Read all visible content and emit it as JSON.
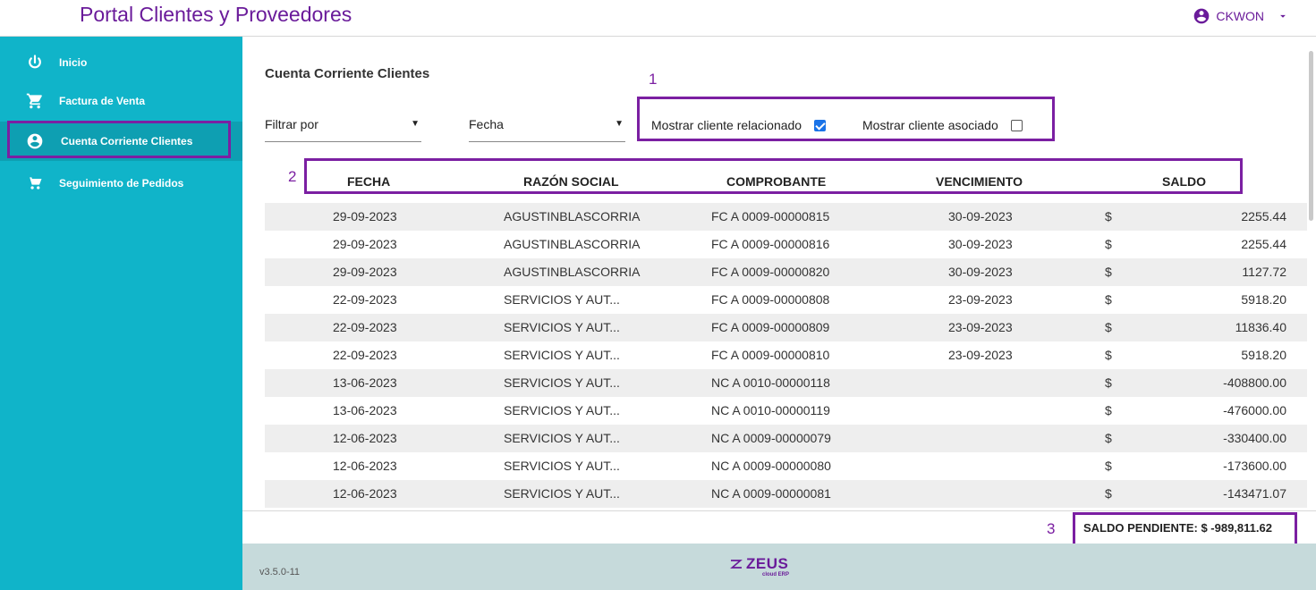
{
  "app": {
    "title": "Portal Clientes y Proveedores",
    "user": "CKWON"
  },
  "sidebar": {
    "items": [
      {
        "label": "Inicio",
        "icon": "power-icon"
      },
      {
        "label": "Factura de Venta",
        "icon": "cart-icon"
      },
      {
        "label": "Cuenta Corriente Clientes",
        "icon": "account-circle-icon",
        "active": true
      },
      {
        "label": "Seguimiento de Pedidos",
        "icon": "shopping-tracking-icon"
      }
    ]
  },
  "main": {
    "title": "Cuenta Corriente Clientes",
    "filter_select": {
      "value": "Filtrar por"
    },
    "fecha_select": {
      "value": "Fecha"
    },
    "checkbox_relacionado": {
      "label": "Mostrar cliente relacionado",
      "checked": true
    },
    "checkbox_asociado": {
      "label": "Mostrar cliente asociado",
      "checked": false
    },
    "table": {
      "headers": [
        "FECHA",
        "RAZÓN SOCIAL",
        "COMPROBANTE",
        "VENCIMIENTO",
        "SALDO"
      ],
      "rows": [
        {
          "fecha": "29-09-2023",
          "razon": "AGUSTINBLASCORRIA",
          "comprobante": "FC A 0009-00000815",
          "vencimiento": "30-09-2023",
          "moneda": "$",
          "saldo": "2255.44"
        },
        {
          "fecha": "29-09-2023",
          "razon": "AGUSTINBLASCORRIA",
          "comprobante": "FC A 0009-00000816",
          "vencimiento": "30-09-2023",
          "moneda": "$",
          "saldo": "2255.44"
        },
        {
          "fecha": "29-09-2023",
          "razon": "AGUSTINBLASCORRIA",
          "comprobante": "FC A 0009-00000820",
          "vencimiento": "30-09-2023",
          "moneda": "$",
          "saldo": "1127.72"
        },
        {
          "fecha": "22-09-2023",
          "razon": "SERVICIOS Y AUT...",
          "comprobante": "FC A 0009-00000808",
          "vencimiento": "23-09-2023",
          "moneda": "$",
          "saldo": "5918.20"
        },
        {
          "fecha": "22-09-2023",
          "razon": "SERVICIOS Y AUT...",
          "comprobante": "FC A 0009-00000809",
          "vencimiento": "23-09-2023",
          "moneda": "$",
          "saldo": "11836.40"
        },
        {
          "fecha": "22-09-2023",
          "razon": "SERVICIOS Y AUT...",
          "comprobante": "FC A 0009-00000810",
          "vencimiento": "23-09-2023",
          "moneda": "$",
          "saldo": "5918.20"
        },
        {
          "fecha": "13-06-2023",
          "razon": "SERVICIOS Y AUT...",
          "comprobante": "NC A 0010-00000118",
          "vencimiento": "",
          "moneda": "$",
          "saldo": "-408800.00"
        },
        {
          "fecha": "13-06-2023",
          "razon": "SERVICIOS Y AUT...",
          "comprobante": "NC A 0010-00000119",
          "vencimiento": "",
          "moneda": "$",
          "saldo": "-476000.00"
        },
        {
          "fecha": "12-06-2023",
          "razon": "SERVICIOS Y AUT...",
          "comprobante": "NC A 0009-00000079",
          "vencimiento": "",
          "moneda": "$",
          "saldo": "-330400.00"
        },
        {
          "fecha": "12-06-2023",
          "razon": "SERVICIOS Y AUT...",
          "comprobante": "NC A 0009-00000080",
          "vencimiento": "",
          "moneda": "$",
          "saldo": "-173600.00"
        },
        {
          "fecha": "12-06-2023",
          "razon": "SERVICIOS Y AUT...",
          "comprobante": "NC A 0009-00000081",
          "vencimiento": "",
          "moneda": "$",
          "saldo": "-143471.07"
        }
      ]
    },
    "saldo_pendiente": "SALDO PENDIENTE: $ -989,811.62"
  },
  "annotations": [
    "1",
    "2",
    "3"
  ],
  "footer": {
    "version": "v3.5.0-11",
    "logo_text": "ZEUS",
    "logo_sub": "cloud ERP"
  },
  "colors": {
    "brand": "#6a1b9a",
    "sidebar": "#10b4c9",
    "footer": "#c6dadb",
    "annotation": "#7b1fa2"
  }
}
